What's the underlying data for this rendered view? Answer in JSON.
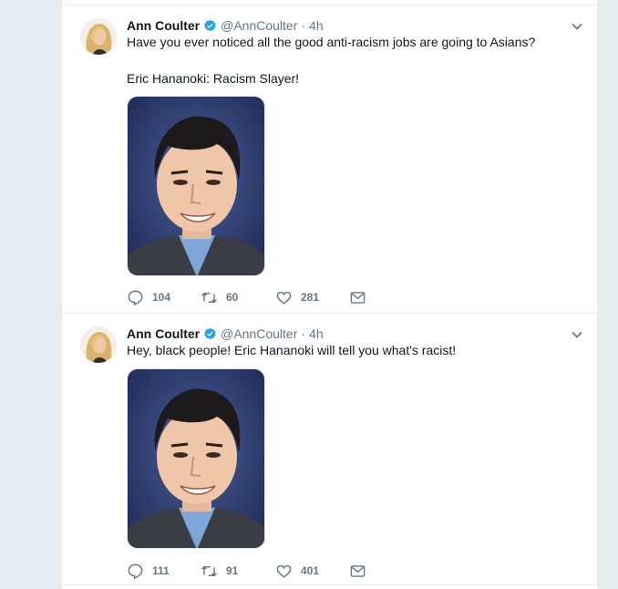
{
  "tweets": [
    {
      "author_name": "Ann Coulter",
      "author_handle": "@AnnCoulter",
      "separator": "·",
      "time": "4h",
      "text_lines": [
        "Have you ever noticed all the good anti-racism jobs are going to Asians?",
        "",
        "Eric Hananoki: Racism Slayer!"
      ],
      "replies": "104",
      "retweets": "60",
      "likes": "281"
    },
    {
      "author_name": "Ann Coulter",
      "author_handle": "@AnnCoulter",
      "separator": "·",
      "time": "4h",
      "text_lines": [
        "Hey, black people! Eric Hananoki will tell you what's racist!"
      ],
      "replies": "111",
      "retweets": "91",
      "likes": "401"
    }
  ],
  "icons": {
    "verified": "verified-badge-icon",
    "caret": "chevron-down-icon",
    "reply": "reply-icon",
    "retweet": "retweet-icon",
    "like": "heart-icon",
    "dm": "envelope-icon"
  },
  "colors": {
    "verified_blue": "#1da1f2",
    "secondary_text": "#657786",
    "primary_text": "#14171a",
    "page_background": "#e6ecf0"
  }
}
